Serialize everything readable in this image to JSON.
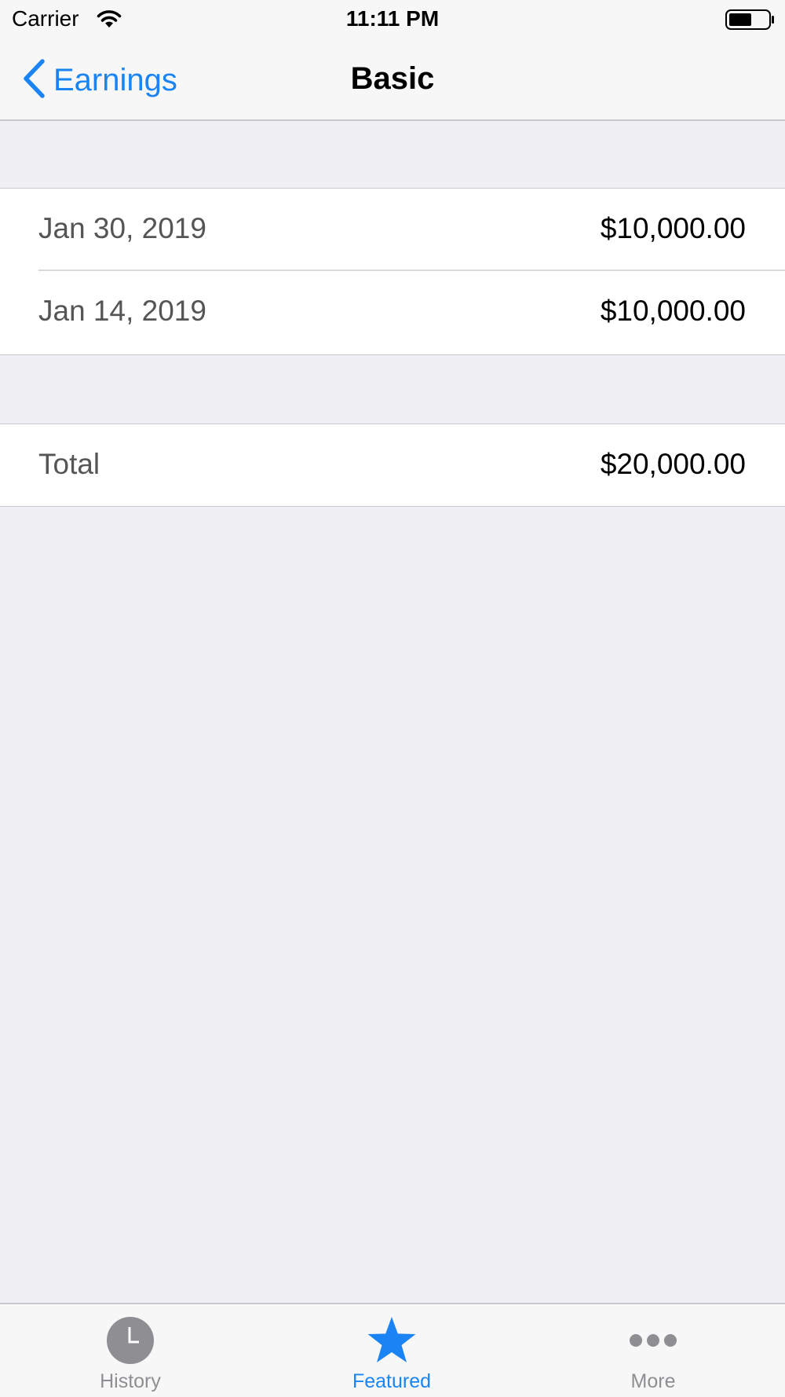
{
  "status_bar": {
    "carrier": "Carrier",
    "time": "11:11 PM",
    "wifi_icon": "wifi-icon",
    "battery_icon": "battery-icon"
  },
  "nav": {
    "back_label": "Earnings",
    "back_icon": "chevron-left-icon",
    "title": "Basic"
  },
  "entries": [
    {
      "date": "Jan 30, 2019",
      "amount": "$10,000.00"
    },
    {
      "date": "Jan 14, 2019",
      "amount": "$10,000.00"
    }
  ],
  "total": {
    "label": "Total",
    "amount": "$20,000.00"
  },
  "tabs": [
    {
      "label": "History",
      "icon": "clock-icon",
      "selected": false
    },
    {
      "label": "Featured",
      "icon": "star-icon",
      "selected": true
    },
    {
      "label": "More",
      "icon": "more-icon",
      "selected": false
    }
  ],
  "colors": {
    "accent": "#1a84f5",
    "background": "#efeff4",
    "inactive_tab": "#8e8e93"
  }
}
